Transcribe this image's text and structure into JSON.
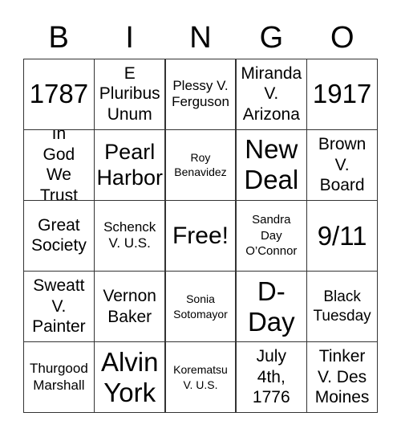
{
  "header": {
    "letters": [
      "B",
      "I",
      "N",
      "G",
      "O"
    ]
  },
  "board": {
    "rows": [
      [
        "1787",
        "E Pluribus Unum",
        "Plessy V. Ferguson",
        "Miranda V. Arizona",
        "1917"
      ],
      [
        "In God We Trust",
        "Pearl Harbor",
        "Roy Benavidez",
        "New Deal",
        "Brown V. Board"
      ],
      [
        "Great Society",
        "Schenck V. U.S.",
        "Free!",
        "Sandra Day O’Connor",
        "9/11"
      ],
      [
        "Sweatt V. Painter",
        "Vernon Baker",
        "Sonia Sotomayor",
        "D-Day",
        "Black Tuesday"
      ],
      [
        "Thurgood Marshall",
        "Alvin York",
        "Korematsu V. U.S.",
        "July 4th, 1776",
        "Tinker V. Des Moines"
      ]
    ],
    "free_space": "Free!"
  },
  "colors": {
    "grid_line": "#333333",
    "cell_background": "#ffffff",
    "text": "#000000"
  }
}
